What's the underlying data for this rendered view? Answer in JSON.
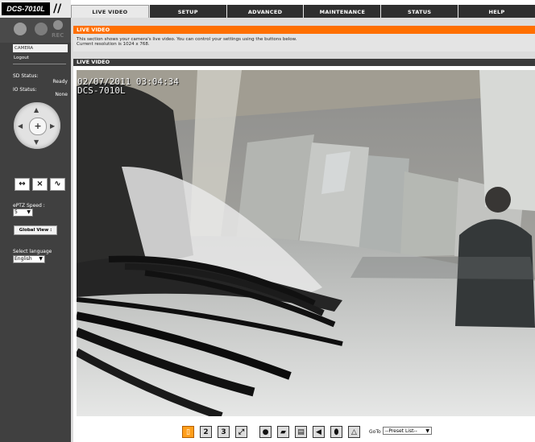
{
  "logo": {
    "brand": "DCS-7010L"
  },
  "nav": {
    "tabs": [
      "LIVE VIDEO",
      "SETUP",
      "ADVANCED",
      "MAINTENANCE",
      "STATUS",
      "HELP"
    ]
  },
  "sidebar": {
    "rec_label": "REC",
    "camera": "CAMERA",
    "logout": "Logout",
    "sd_status_label": "SD Status:",
    "sd_status_value": "Ready",
    "io_status_label": "IO Status:",
    "io_status_value": "None",
    "eptz_speed_label": "ePTZ Speed :",
    "eptz_speed_value": "5",
    "global_view": "Global View :",
    "select_language_label": "Select language",
    "language": "English"
  },
  "section": {
    "title": "LIVE VIDEO",
    "desc_line1": "This section shows your camera's live video. You can control your settings using the buttons below.",
    "desc_line2": "Current resolution is 1024 x 768.",
    "live_header": "LIVE VIDEO"
  },
  "video": {
    "timestamp": "02/07/2011 03:04:34",
    "camera_label": "DCS-7010L"
  },
  "toolbar": {
    "goto_label": "GoTo",
    "preset_value": "--Preset List--"
  },
  "colors": {
    "accent": "#ff6f00",
    "sidebar": "#404040",
    "header": "#3b3b3b"
  },
  "icons": [
    "ptz-up-icon",
    "ptz-down-icon",
    "ptz-left-icon",
    "ptz-right-icon",
    "home-icon",
    "snapshot-icon",
    "record-icon",
    "audio-icon",
    "microphone-icon",
    "warning-icon"
  ]
}
